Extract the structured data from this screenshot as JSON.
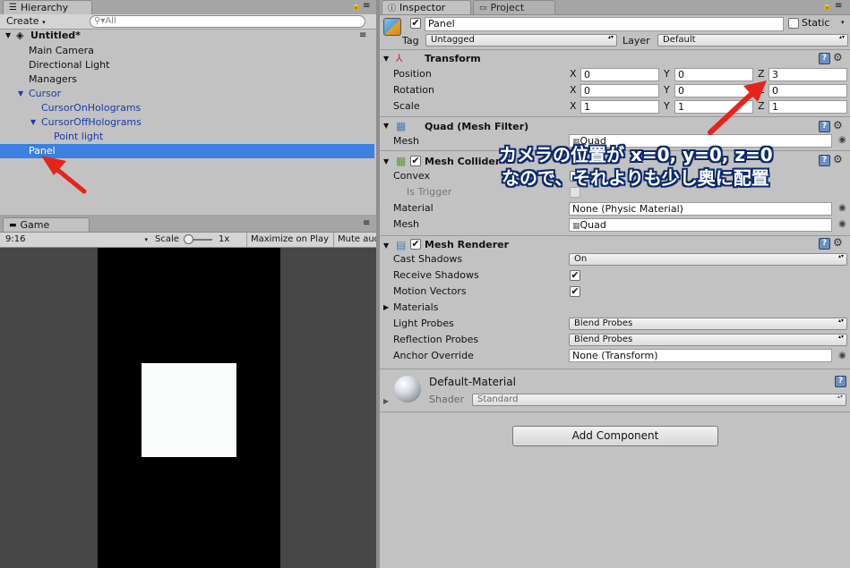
{
  "hierarchy": {
    "tab_label": "Hierarchy",
    "create_label": "Create",
    "search_placeholder": "All",
    "scene_name": "Untitled*",
    "items": [
      {
        "label": "Main Camera"
      },
      {
        "label": "Directional Light"
      },
      {
        "label": "Managers"
      },
      {
        "label": "Cursor"
      },
      {
        "label": "CursorOnHolograms"
      },
      {
        "label": "CursorOffHolograms"
      },
      {
        "label": "Point light"
      },
      {
        "label": "Panel"
      }
    ]
  },
  "game": {
    "tab_label": "Game",
    "aspect": "9:16",
    "scale_label": "Scale",
    "scale_value": "1x",
    "maximize_label": "Maximize on Play",
    "mute_label": "Mute audio"
  },
  "inspector": {
    "tab_label": "Inspector",
    "project_tab_label": "Project",
    "object_name": "Panel",
    "static_label": "Static",
    "tag_label": "Tag",
    "tag_value": "Untagged",
    "layer_label": "Layer",
    "layer_value": "Default",
    "transform": {
      "title": "Transform",
      "rows": [
        {
          "label": "Position",
          "x": "0",
          "y": "0",
          "z": "3"
        },
        {
          "label": "Rotation",
          "x": "0",
          "y": "0",
          "z": "0"
        },
        {
          "label": "Scale",
          "x": "1",
          "y": "1",
          "z": "1"
        }
      ],
      "axis_x": "X",
      "axis_y": "Y",
      "axis_z": "Z"
    },
    "mesh_filter": {
      "title": "Quad (Mesh Filter)",
      "mesh_label": "Mesh",
      "mesh_value": "Quad"
    },
    "mesh_collider": {
      "title": "Mesh Collider",
      "convex_label": "Convex",
      "trigger_label": "Is Trigger",
      "material_label": "Material",
      "material_value": "None (Physic Material)",
      "mesh_label": "Mesh",
      "mesh_value": "Quad"
    },
    "mesh_renderer": {
      "title": "Mesh Renderer",
      "cast_shadows_label": "Cast Shadows",
      "cast_shadows_value": "On",
      "receive_shadows_label": "Receive Shadows",
      "motion_vectors_label": "Motion Vectors",
      "materials_label": "Materials",
      "light_probes_label": "Light Probes",
      "light_probes_value": "Blend Probes",
      "reflection_probes_label": "Reflection Probes",
      "reflection_probes_value": "Blend Probes",
      "anchor_label": "Anchor Override",
      "anchor_value": "None (Transform)"
    },
    "material": {
      "name": "Default-Material",
      "shader_label": "Shader",
      "shader_value": "Standard"
    },
    "add_component_label": "Add Component"
  },
  "annotation": {
    "line1": "カメラの位置が x=0, y=0, z=0",
    "line2": "なので、それよりも少し奥に配置",
    "arrow_color": "#e8231a"
  }
}
